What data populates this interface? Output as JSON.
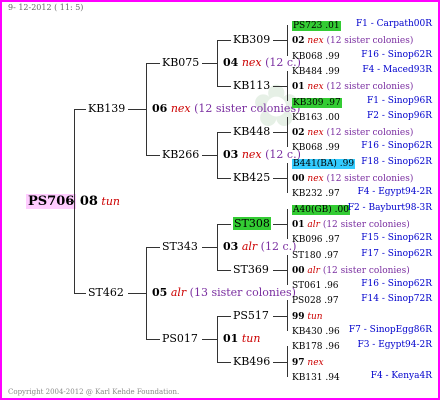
{
  "date": "9- 12-2012 ( 11: 5)",
  "copyright": "Copyright 2004-2012 @ Karl Kehde Foundation.",
  "subject": {
    "name": "PS706",
    "num": "08",
    "note": "tun"
  },
  "gen1": [
    {
      "name": "KB139",
      "num": "06",
      "note": "nex",
      "sister": "(12 sister colonies)"
    },
    {
      "name": "ST462",
      "num": "05",
      "note": "alr",
      "sister": "(13 sister colonies)"
    }
  ],
  "gen2": [
    {
      "name": "KB075",
      "num": "04",
      "note": "nex",
      "sister": "(12 c.)"
    },
    {
      "name": "KB266",
      "num": "03",
      "note": "nex",
      "sister": "(12 c.)"
    },
    {
      "name": "ST343",
      "num": "03",
      "note": "alr",
      "sister": "(12 c.)"
    },
    {
      "name": "PS017",
      "num": "01",
      "note": "tun",
      "sister": ""
    }
  ],
  "gen3": [
    "KB309",
    "KB113",
    "KB448",
    "KB425",
    "ST308",
    "ST369",
    "PS517",
    "KB496"
  ],
  "gen4": [
    {
      "label": "PS723 .01",
      "hl": "g",
      "right": "F1 - Carpath00R"
    },
    {
      "label": "02",
      "note": "nex",
      "sister": "(12 sister colonies)"
    },
    {
      "label": "KB068 .99",
      "right": "F16 - Sinop62R"
    },
    {
      "label": "KB484 .99",
      "right": "F4 - Maced93R"
    },
    {
      "label": "01",
      "note": "nex",
      "sister": "(12 sister colonies)"
    },
    {
      "label": "KB309 .97",
      "hl": "g",
      "right": "F1 - Sinop96R"
    },
    {
      "label": "KB163 .00",
      "right": "F2 - Sinop96R"
    },
    {
      "label": "02",
      "note": "nex",
      "sister": "(12 sister colonies)"
    },
    {
      "label": "KB068 .99",
      "right": "F16 - Sinop62R"
    },
    {
      "label": "B441(BA) .99",
      "hl": "c",
      "right": "F18 - Sinop62R"
    },
    {
      "label": "00",
      "note": "nex",
      "sister": "(12 sister colonies)"
    },
    {
      "label": "KB232 .97",
      "right": "F4 - Egypt94-2R"
    },
    {
      "label": "A40(GB) .00",
      "hl": "g",
      "right": "F2 - Bayburt98-3R"
    },
    {
      "label": "01",
      "note": "alr",
      "sister": "(12 sister colonies)"
    },
    {
      "label": "KB096 .97",
      "right": "F15 - Sinop62R"
    },
    {
      "label": "ST180 .97",
      "right": "F17 - Sinop62R"
    },
    {
      "label": "00",
      "note": "alr",
      "sister": "(12 sister colonies)"
    },
    {
      "label": "ST061 .96",
      "right": "F16 - Sinop62R"
    },
    {
      "label": "PS028 .97",
      "right": "F14 - Sinop72R"
    },
    {
      "label": "99",
      "note": "tun",
      "sister": ""
    },
    {
      "label": "KB430 .96",
      "right": "F7 - SinopEgg86R"
    },
    {
      "label": "KB178 .96",
      "right": "F3 - Egypt94-2R"
    },
    {
      "label": "97",
      "note": "nex",
      "sister": ""
    },
    {
      "label": "KB131 .94",
      "right": "F4 - Kenya4R"
    }
  ],
  "st308_hl": "ST308"
}
